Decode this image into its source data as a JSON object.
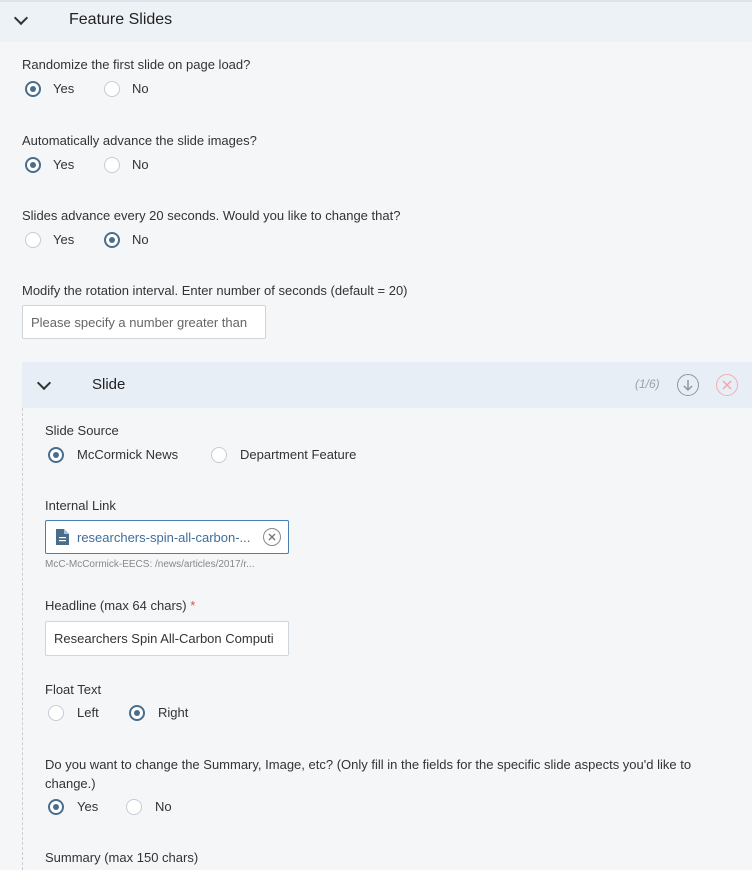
{
  "section": {
    "title": "Feature Slides"
  },
  "questions": {
    "randomize": {
      "label": "Randomize the first slide on page load?",
      "options": [
        "Yes",
        "No"
      ],
      "selected": "Yes"
    },
    "auto_advance": {
      "label": "Automatically advance the slide images?",
      "options": [
        "Yes",
        "No"
      ],
      "selected": "Yes"
    },
    "change_interval": {
      "label": "Slides advance every 20 seconds. Would you like to change that?",
      "options": [
        "Yes",
        "No"
      ],
      "selected": "No"
    },
    "rotation": {
      "label": "Modify the rotation interval. Enter number of seconds (default = 20)",
      "placeholder": "Please specify a number greater than",
      "value": ""
    }
  },
  "slide": {
    "title": "Slide",
    "count": "(1/6)",
    "source": {
      "label": "Slide Source",
      "options": [
        "McCormick News",
        "Department Feature"
      ],
      "selected": "McCormick News"
    },
    "internal_link": {
      "label": "Internal Link",
      "value": "researchers-spin-all-carbon-...",
      "path": "McC-McCormick-EECS: /news/articles/2017/r..."
    },
    "headline": {
      "label": "Headline (max 64 chars)",
      "required_mark": "*",
      "value": "Researchers Spin All-Carbon Computi"
    },
    "float_text": {
      "label": "Float Text",
      "options": [
        "Left",
        "Right"
      ],
      "selected": "Right"
    },
    "change_summary": {
      "label_line1": "Do you want to change the Summary, Image, etc? (Only fill in the fields for the specific slide aspects you'd like to",
      "label_line2": "change.)",
      "options": [
        "Yes",
        "No"
      ],
      "selected": "Yes"
    },
    "summary": {
      "label": "Summary (max 150 chars)"
    }
  },
  "icons": {
    "collapse": "chevron-down-icon",
    "move_down": "arrow-down-circle-icon",
    "remove": "close-circle-icon",
    "document": "document-icon",
    "clear": "clear-icon"
  },
  "colors": {
    "accent": "#4a6d8c",
    "link": "#3d6f9e",
    "required": "#d9534f",
    "remove": "#f0b0b0"
  }
}
